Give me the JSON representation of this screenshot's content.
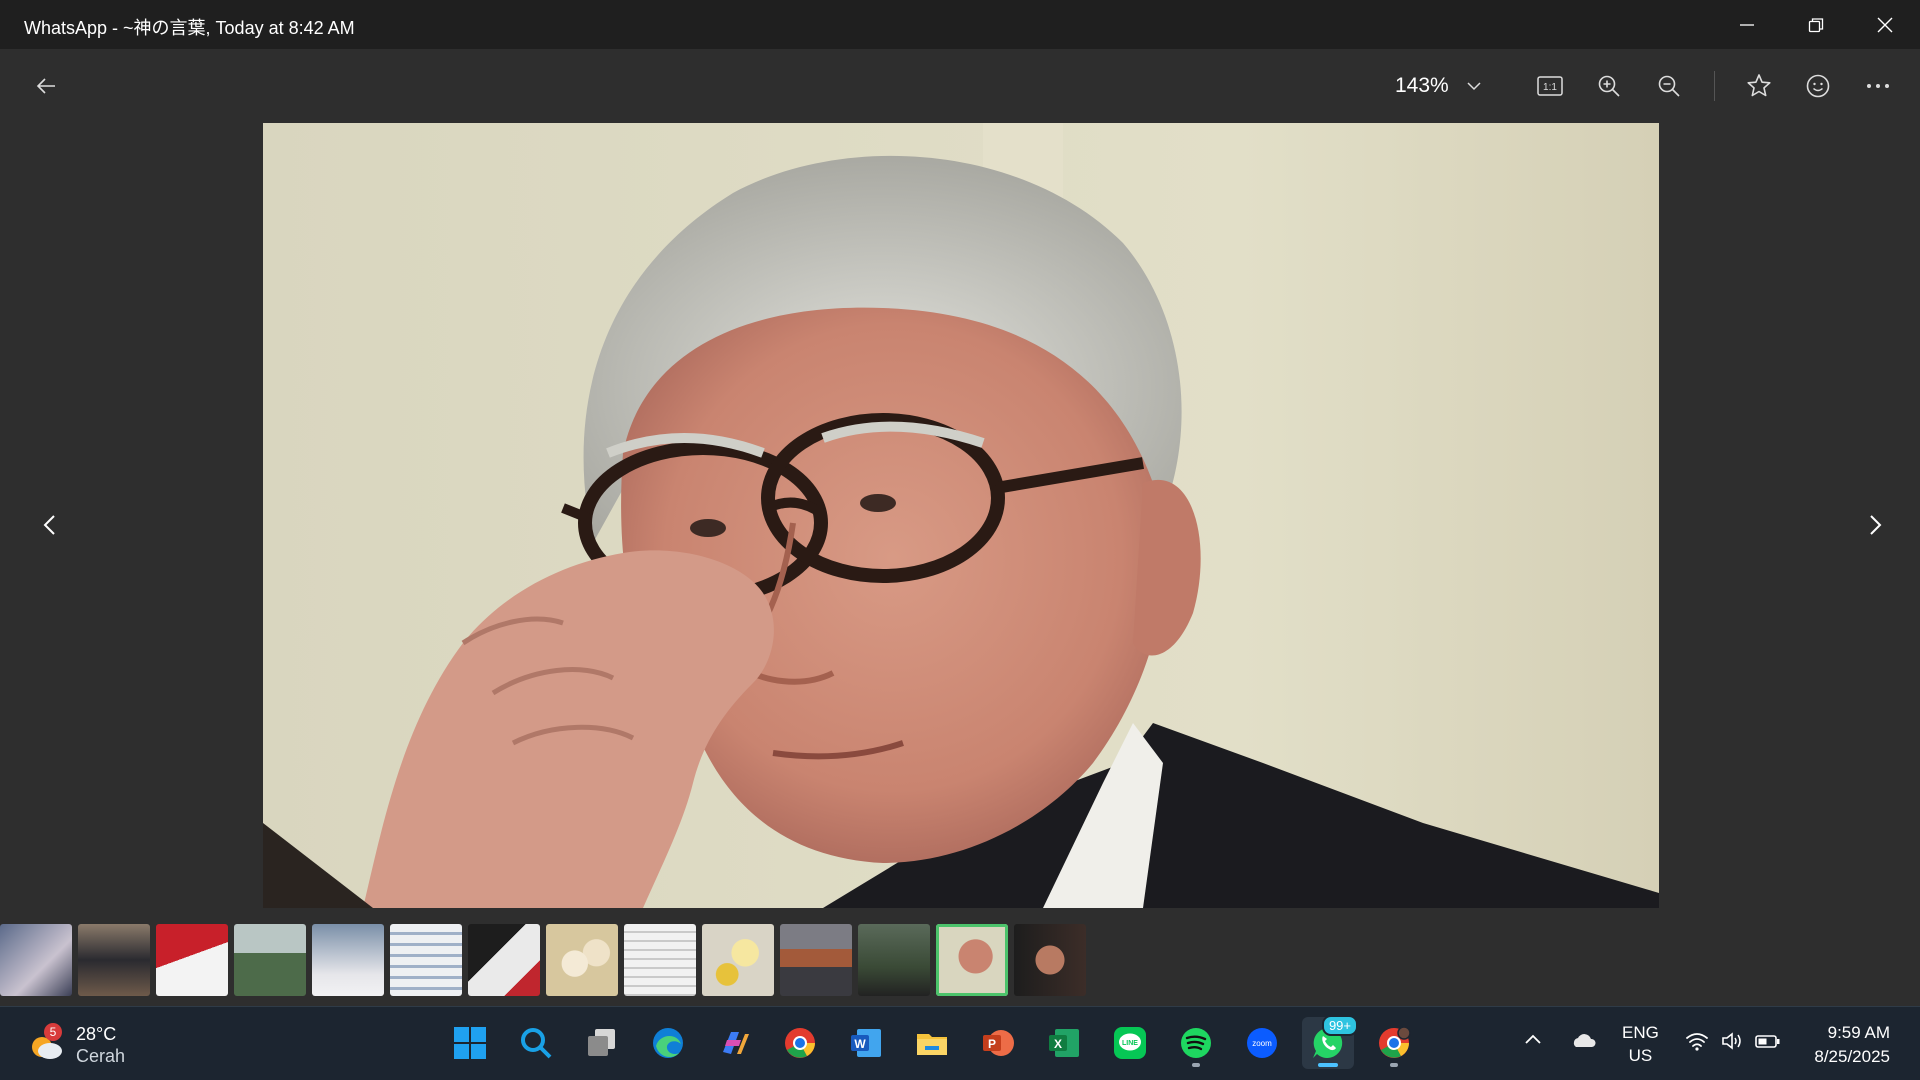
{
  "window": {
    "title": "WhatsApp - ~神の言葉, Today at 8:42 AM"
  },
  "toolbar": {
    "zoom_level": "143%",
    "actual_size_label": "1:1"
  },
  "thumbnails": {
    "count": 14,
    "selected_index": 12
  },
  "taskbar": {
    "weather": {
      "badge": "5",
      "temp": "28°C",
      "condition": "Cerah"
    },
    "pinned_apps": [
      "windows-start",
      "search",
      "task-view",
      "edge",
      "copilot",
      "chrome",
      "word",
      "file-explorer",
      "powerpoint",
      "excel",
      "line",
      "spotify",
      "zoom",
      "whatsapp",
      "chrome-profile"
    ],
    "whatsapp_badge": "99+",
    "language": {
      "line1": "ENG",
      "line2": "US"
    },
    "time": "9:59 AM",
    "date": "8/25/2025"
  },
  "colors": {
    "accent_green": "#4cc36b",
    "taskbar": "#1c2530",
    "viewer_bg": "#2e2e2e"
  }
}
